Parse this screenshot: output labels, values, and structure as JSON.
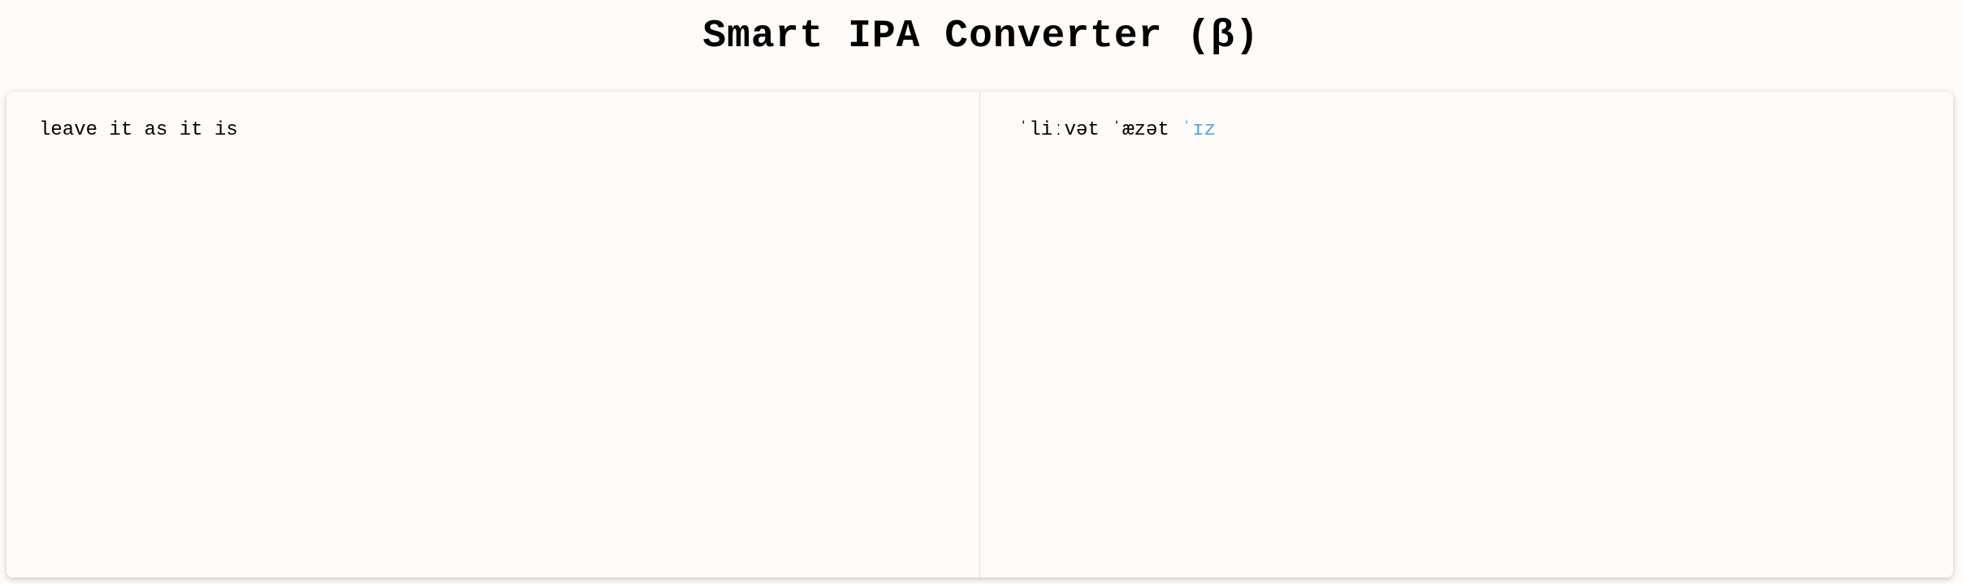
{
  "title": "Smart IPA Converter (β)",
  "input": {
    "value": "leave it as it is"
  },
  "output": {
    "words": [
      {
        "text": "ˈliːvət",
        "highlighted": false
      },
      {
        "text": "ˈæzət",
        "highlighted": false
      },
      {
        "text": "ˈɪz",
        "highlighted": true
      }
    ]
  },
  "colors": {
    "background": "#fffbf8",
    "highlight": "#4aa8e8"
  }
}
